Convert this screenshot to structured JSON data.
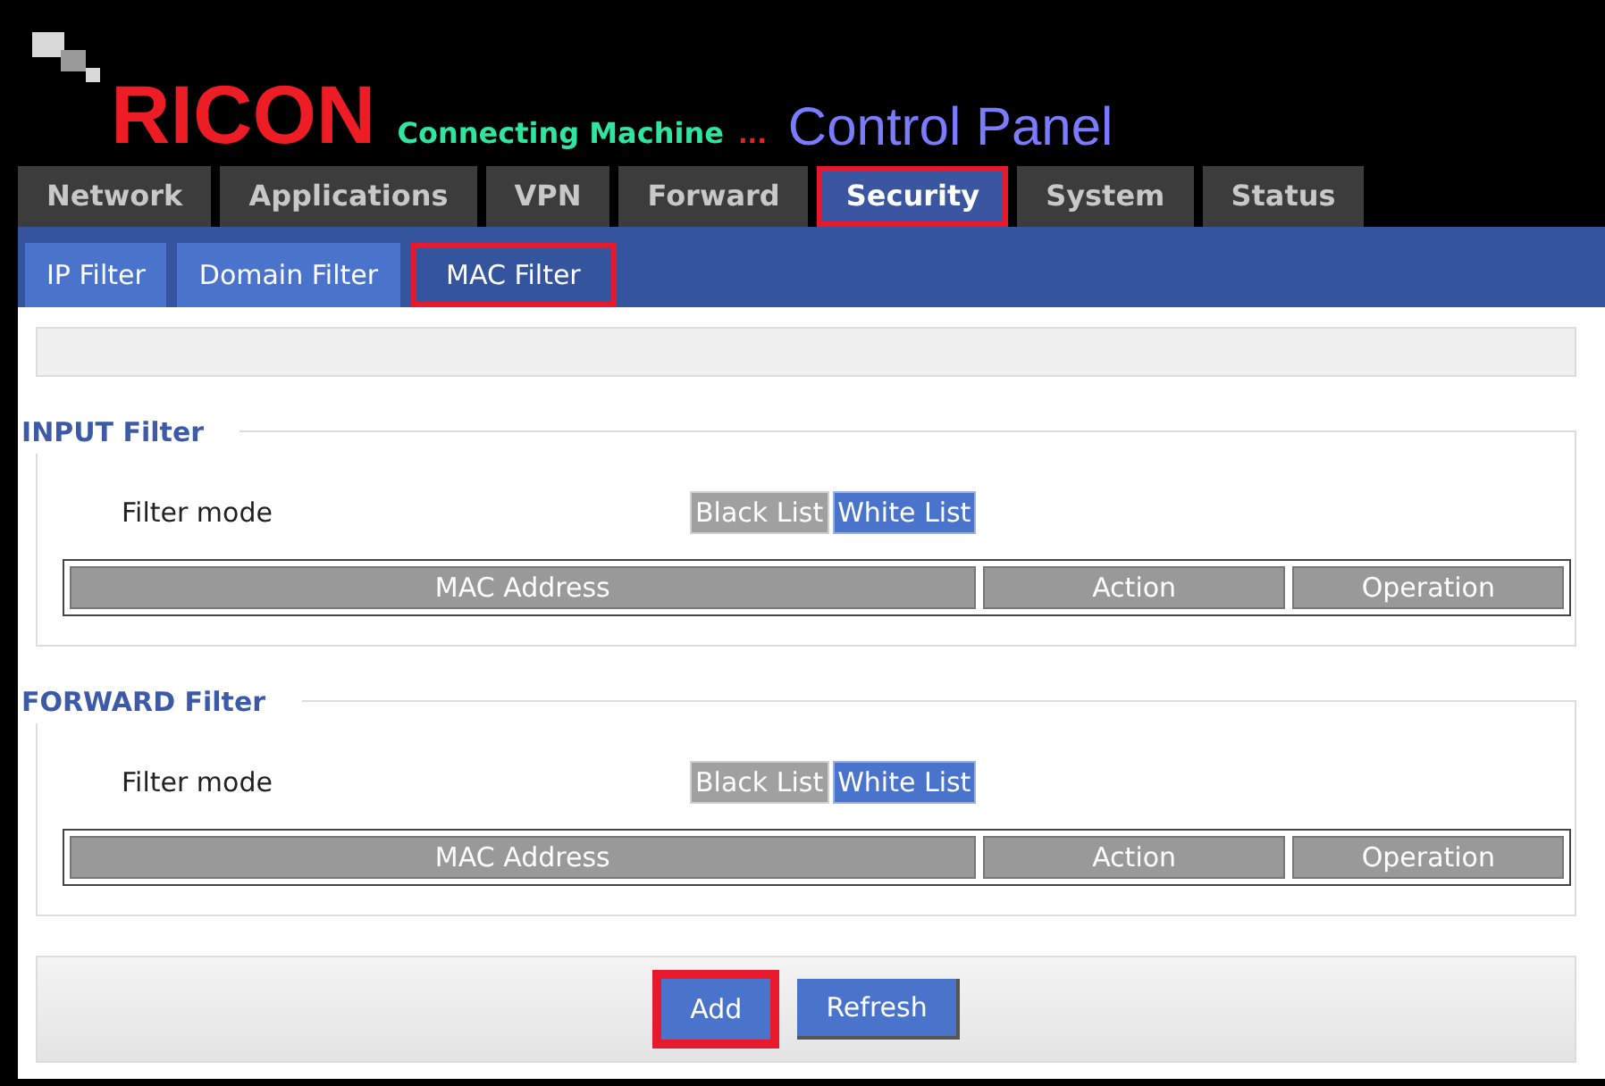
{
  "header": {
    "brand": "RICON",
    "tagline": "Connecting Machine",
    "ellipsis": "...",
    "title": "Control Panel"
  },
  "tabs": [
    {
      "label": "Network",
      "selected": false,
      "highlighted": false
    },
    {
      "label": "Applications",
      "selected": false,
      "highlighted": false
    },
    {
      "label": "VPN",
      "selected": false,
      "highlighted": false
    },
    {
      "label": "Forward",
      "selected": false,
      "highlighted": false
    },
    {
      "label": "Security",
      "selected": true,
      "highlighted": true
    },
    {
      "label": "System",
      "selected": false,
      "highlighted": false
    },
    {
      "label": "Status",
      "selected": false,
      "highlighted": false
    }
  ],
  "subtabs": [
    {
      "label": "IP Filter",
      "selected": false,
      "highlighted": false
    },
    {
      "label": "Domain Filter",
      "selected": false,
      "highlighted": false
    },
    {
      "label": "MAC Filter",
      "selected": true,
      "highlighted": true
    }
  ],
  "sections": [
    {
      "title": "INPUT Filter",
      "mode_label": "Filter mode",
      "modes": [
        {
          "label": "Black List",
          "selected": false
        },
        {
          "label": "White List",
          "selected": true
        }
      ],
      "columns": [
        "MAC Address",
        "Action",
        "Operation"
      ]
    },
    {
      "title": "FORWARD Filter",
      "mode_label": "Filter mode",
      "modes": [
        {
          "label": "Black List",
          "selected": false
        },
        {
          "label": "White List",
          "selected": true
        }
      ],
      "columns": [
        "MAC Address",
        "Action",
        "Operation"
      ]
    }
  ],
  "buttons": [
    {
      "label": "Add",
      "highlighted": true
    },
    {
      "label": "Refresh",
      "highlighted": false
    }
  ]
}
